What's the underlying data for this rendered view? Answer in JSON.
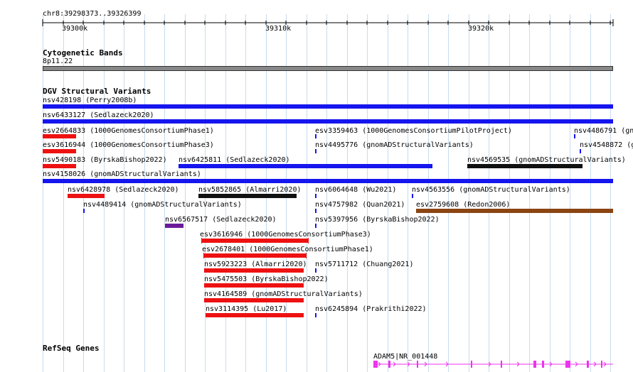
{
  "ruler": {
    "locus": "chr8:39298373..39326399",
    "ticks": [
      "39300k",
      "39310k",
      "39320k"
    ]
  },
  "tracks": {
    "cytoband": {
      "title": "Cytogenetic Bands",
      "band": "8p11.22"
    },
    "dgv": {
      "title": "DGV Structural Variants"
    },
    "refseq": {
      "title": "RefSeq Genes",
      "gene": "ADAM5|NR_001448"
    }
  },
  "variants": [
    "nsv428198 (Perry2008b)",
    "nsv6433127 (Sedlazeck2020)",
    "esv2664833 (1000GenomesConsortiumPhase1)",
    "esv3359463 (1000GenomesConsortiumPilotProject)",
    "nsv4486791 (gn",
    "esv3616944 (1000GenomesConsortiumPhase3)",
    "nsv4495776 (gnomADStructuralVariants)",
    "nsv4548872 (g",
    "nsv5490183 (ByrskaBishop2022)",
    "nsv6425811 (Sedlazeck2020)",
    "nsv4569535 (gnomADStructuralVariants)",
    "nsv4158026 (gnomADStructuralVariants)",
    "nsv6428978 (Sedlazeck2020)",
    "nsv5852865 (Almarri2020)",
    "nsv6064648 (Wu2021)",
    "nsv4563556 (gnomADStructuralVariants)",
    "nsv4489414 (gnomADStructuralVariants)",
    "nsv4757982 (Quan2021)",
    "esv2759608 (Redon2006)",
    "nsv6567517 (Sedlazeck2020)",
    "nsv5397956 (ByrskaBishop2022)",
    "esv3616946 (1000GenomesConsortiumPhase3)",
    "esv2678401 (1000GenomesConsortiumPhase1)",
    "nsv5923223 (Almarri2020)",
    "nsv5711712 (Chuang2021)",
    "nsv5475503 (ByrskaBishop2022)",
    "nsv4164589 (gnomADStructuralVariants)",
    "nsv3114395 (Lu2017)",
    "nsv6245894 (Prakrithi2022)"
  ],
  "colors": {
    "loss": "#ee1111",
    "gain": "#1515ee",
    "gainloss": "#111111",
    "complex": "#8b4513",
    "inversion": "#6a1b9a",
    "gene": "#ee33ee",
    "cytoband": "#888888",
    "grid": "#c7dcee"
  }
}
